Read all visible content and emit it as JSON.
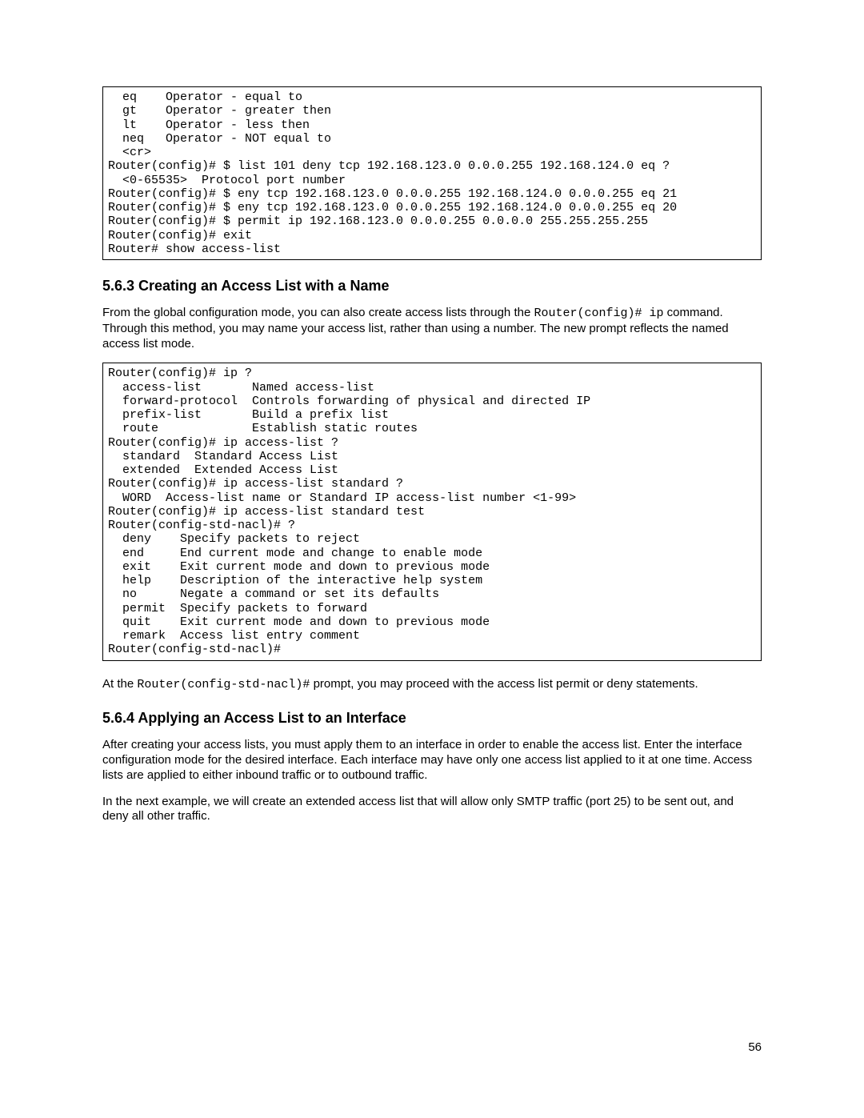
{
  "code_block_1": "  eq    Operator - equal to\n  gt    Operator - greater then\n  lt    Operator - less then\n  neq   Operator - NOT equal to\n  <cr>\nRouter(config)# $ list 101 deny tcp 192.168.123.0 0.0.0.255 192.168.124.0 eq ?\n  <0-65535>  Protocol port number\nRouter(config)# $ eny tcp 192.168.123.0 0.0.0.255 192.168.124.0 0.0.0.255 eq 21\nRouter(config)# $ eny tcp 192.168.123.0 0.0.0.255 192.168.124.0 0.0.0.255 eq 20\nRouter(config)# $ permit ip 192.168.123.0 0.0.0.255 0.0.0.0 255.255.255.255\nRouter(config)# exit\nRouter# show access-list",
  "section_563": {
    "heading": "5.6.3 Creating an Access List with a Name",
    "para_pre": "From the global configuration mode, you can also create access lists through the ",
    "para_code": "Router(config)# ip",
    "para_post": " command. Through this method, you may name your access list, rather than using a number. The new prompt reflects the named access list mode."
  },
  "code_block_2": "Router(config)# ip ?\n  access-list       Named access-list\n  forward-protocol  Controls forwarding of physical and directed IP\n  prefix-list       Build a prefix list\n  route             Establish static routes\nRouter(config)# ip access-list ?\n  standard  Standard Access List\n  extended  Extended Access List\nRouter(config)# ip access-list standard ?\n  WORD  Access-list name or Standard IP access-list number <1-99>\nRouter(config)# ip access-list standard test\nRouter(config-std-nacl)# ?\n  deny    Specify packets to reject\n  end     End current mode and change to enable mode\n  exit    Exit current mode and down to previous mode\n  help    Description of the interactive help system\n  no      Negate a command or set its defaults\n  permit  Specify packets to forward\n  quit    Exit current mode and down to previous mode\n  remark  Access list entry comment\nRouter(config-std-nacl)#",
  "after_code2": {
    "para_pre": "At the ",
    "para_code": "Router(config-std-nacl)#",
    "para_post": " prompt, you may proceed with the access list permit or deny statements."
  },
  "section_564": {
    "heading": "5.6.4 Applying an Access List to an Interface",
    "para1": "After creating your access lists, you must apply them to an interface in order to enable the access list. Enter the interface configuration mode for the desired interface. Each interface may have only one access list applied to it at one time. Access lists are applied to either inbound traffic or to outbound traffic.",
    "para2": "In the next example, we will create an extended access list that will allow only SMTP traffic (port 25) to be sent out, and deny all other traffic."
  },
  "page_number": "56"
}
